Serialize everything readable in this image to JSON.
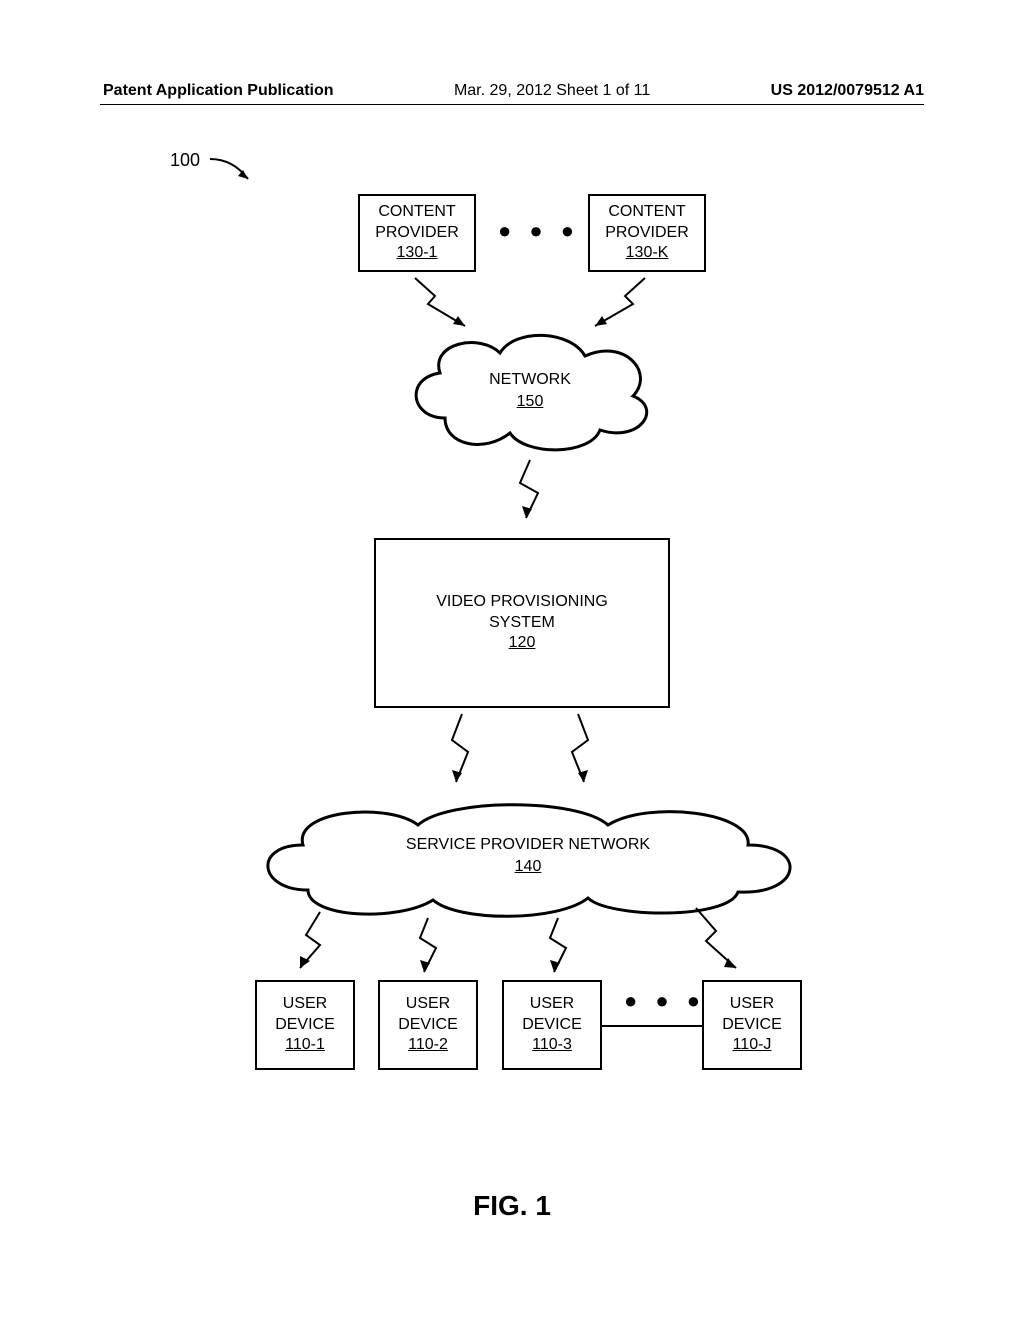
{
  "header": {
    "left": "Patent Application Publication",
    "middle": "Mar. 29, 2012   Sheet 1 of 11",
    "right": "US 2012/0079512 A1"
  },
  "figure_ref": "100",
  "nodes": {
    "content_provider_1": {
      "label": "CONTENT PROVIDER",
      "ref": "130-1"
    },
    "content_provider_k": {
      "label": "CONTENT PROVIDER",
      "ref": "130-K"
    },
    "network": {
      "label": "NETWORK",
      "ref": "150"
    },
    "video_provisioning": {
      "label": "VIDEO PROVISIONING SYSTEM",
      "ref": "120"
    },
    "service_provider_network": {
      "label": "SERVICE  PROVIDER NETWORK",
      "ref": "140"
    },
    "user_device_1": {
      "label": "USER DEVICE",
      "ref": "110-1"
    },
    "user_device_2": {
      "label": "USER DEVICE",
      "ref": "110-2"
    },
    "user_device_3": {
      "label": "USER DEVICE",
      "ref": "110-3"
    },
    "user_device_j": {
      "label": "USER DEVICE",
      "ref": "110-J"
    }
  },
  "dots": "● ● ●",
  "caption": "FIG. 1"
}
